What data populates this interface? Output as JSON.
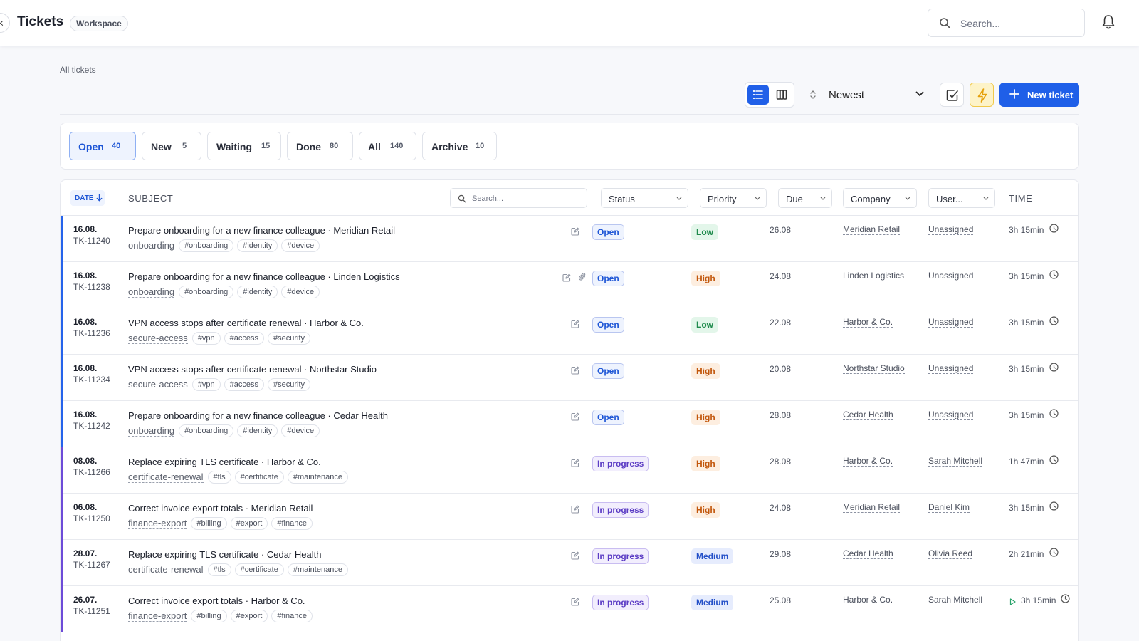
{
  "header": {
    "title": "Tickets",
    "badge": "Workspace",
    "search_placeholder": "Search..."
  },
  "breadcrumb": "All tickets",
  "toolbar": {
    "sort_label": "Newest",
    "new_ticket_label": "New ticket",
    "active_view": "list"
  },
  "filter_tabs": [
    {
      "label": "Open",
      "count": "40",
      "active": true
    },
    {
      "label": "New",
      "count": "5"
    },
    {
      "label": "Waiting",
      "count": "15"
    },
    {
      "label": "Done",
      "count": "80"
    },
    {
      "label": "All",
      "count": "140"
    },
    {
      "label": "Archive",
      "count": "10"
    }
  ],
  "table": {
    "date_header": "DATE",
    "subject_header": "SUBJECT",
    "search_placeholder": "Search...",
    "filters": [
      "Status",
      "Priority",
      "Due",
      "Company",
      "User..."
    ],
    "time_header": "TIME"
  },
  "rows": [
    {
      "date": "16.08.",
      "id": "TK-11240",
      "subject": "Prepare onboarding for a new finance colleague · Meridian Retail",
      "category": "onboarding",
      "tags": [
        "#onboarding",
        "#identity",
        "#device"
      ],
      "status": "Open",
      "priority": "Low",
      "due": "26.08",
      "company": "Meridian Retail",
      "user": "Unassigned",
      "time": "3h 15min"
    },
    {
      "date": "16.08.",
      "id": "TK-11238",
      "subject": "Prepare onboarding for a new finance colleague · Linden Logistics",
      "category": "onboarding",
      "tags": [
        "#onboarding",
        "#identity",
        "#device"
      ],
      "status": "Open",
      "priority": "High",
      "due": "24.08",
      "company": "Linden Logistics",
      "user": "Unassigned",
      "time": "3h 15min",
      "attachment": true
    },
    {
      "date": "16.08.",
      "id": "TK-11236",
      "subject": "VPN access stops after certificate renewal · Harbor & Co.",
      "category": "secure-access",
      "tags": [
        "#vpn",
        "#access",
        "#security"
      ],
      "status": "Open",
      "priority": "Low",
      "due": "22.08",
      "company": "Harbor & Co.",
      "user": "Unassigned",
      "time": "3h 15min"
    },
    {
      "date": "16.08.",
      "id": "TK-11234",
      "subject": "VPN access stops after certificate renewal · Northstar Studio",
      "category": "secure-access",
      "tags": [
        "#vpn",
        "#access",
        "#security"
      ],
      "status": "Open",
      "priority": "High",
      "due": "20.08",
      "company": "Northstar Studio",
      "user": "Unassigned",
      "time": "3h 15min"
    },
    {
      "date": "16.08.",
      "id": "TK-11242",
      "subject": "Prepare onboarding for a new finance colleague · Cedar Health",
      "category": "onboarding",
      "tags": [
        "#onboarding",
        "#identity",
        "#device"
      ],
      "status": "Open",
      "priority": "High",
      "due": "28.08",
      "company": "Cedar Health",
      "user": "Unassigned",
      "time": "3h 15min"
    },
    {
      "date": "08.08.",
      "id": "TK-11266",
      "subject": "Replace expiring TLS certificate · Harbor & Co.",
      "category": "certificate-renewal",
      "tags": [
        "#tls",
        "#certificate",
        "#maintenance"
      ],
      "status": "In progress",
      "priority": "High",
      "due": "28.08",
      "company": "Harbor & Co.",
      "user": "Sarah Mitchell",
      "time": "1h 47min"
    },
    {
      "date": "06.08.",
      "id": "TK-11250",
      "subject": "Correct invoice export totals · Meridian Retail",
      "category": "finance-export",
      "tags": [
        "#billing",
        "#export",
        "#finance"
      ],
      "status": "In progress",
      "priority": "High",
      "due": "24.08",
      "company": "Meridian Retail",
      "user": "Daniel Kim",
      "time": "3h 15min"
    },
    {
      "date": "28.07.",
      "id": "TK-11267",
      "subject": "Replace expiring TLS certificate · Cedar Health",
      "category": "certificate-renewal",
      "tags": [
        "#tls",
        "#certificate",
        "#maintenance"
      ],
      "status": "In progress",
      "priority": "Medium",
      "due": "29.08",
      "company": "Cedar Health",
      "user": "Olivia Reed",
      "time": "2h 21min"
    },
    {
      "date": "26.07.",
      "id": "TK-11251",
      "subject": "Correct invoice export totals · Harbor & Co.",
      "category": "finance-export",
      "tags": [
        "#billing",
        "#export",
        "#finance"
      ],
      "status": "In progress",
      "priority": "Medium",
      "due": "25.08",
      "company": "Harbor & Co.",
      "user": "Sarah Mitchell",
      "time": "3h 15min",
      "timer_running": true
    }
  ],
  "colors": {
    "accent": "#1f5fe8",
    "open_bar": "#2563eb",
    "progress_bar": "#6d4bd8",
    "low_bg": "#e3f6ea",
    "low_fg": "#1f8a4c",
    "high_bg": "#fdeee0",
    "high_fg": "#c2570c",
    "medium_bg": "#e6ecfd",
    "medium_fg": "#2450c8",
    "open_fg": "#1e56d6",
    "progress_fg": "#5b3cc4"
  }
}
